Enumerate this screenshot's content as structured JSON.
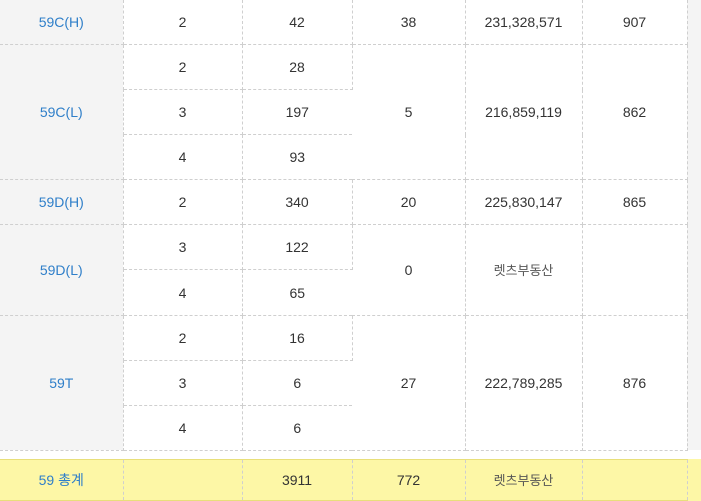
{
  "rows": [
    {
      "type": "59C(H)",
      "sub": [
        {
          "rooms": "2",
          "count": "42"
        }
      ],
      "supply": "38",
      "price": "231,328,571",
      "area": "907"
    },
    {
      "type": "59C(L)",
      "sub": [
        {
          "rooms": "2",
          "count": "28"
        },
        {
          "rooms": "3",
          "count": "197"
        },
        {
          "rooms": "4",
          "count": "93"
        }
      ],
      "supply": "5",
      "price": "216,859,119",
      "area": "862"
    },
    {
      "type": "59D(H)",
      "sub": [
        {
          "rooms": "2",
          "count": "340"
        }
      ],
      "supply": "20",
      "price": "225,830,147",
      "area": "865"
    },
    {
      "type": "59D(L)",
      "sub": [
        {
          "rooms": "3",
          "count": "122"
        },
        {
          "rooms": "4",
          "count": "65"
        }
      ],
      "supply": "0",
      "price": "렛츠부동산",
      "area": ""
    },
    {
      "type": "59T",
      "sub": [
        {
          "rooms": "2",
          "count": "16"
        },
        {
          "rooms": "3",
          "count": "6"
        },
        {
          "rooms": "4",
          "count": "6"
        }
      ],
      "supply": "27",
      "price": "222,789,285",
      "area": "876"
    }
  ],
  "total": {
    "label": "59 총계",
    "rooms": "",
    "count": "3911",
    "supply": "772",
    "price": "렛츠부동산",
    "area": ""
  },
  "colors": {
    "type_link": "#2f7fc9",
    "type_bg": "#f4f4f4",
    "total_bg": "#fdf7a6"
  }
}
